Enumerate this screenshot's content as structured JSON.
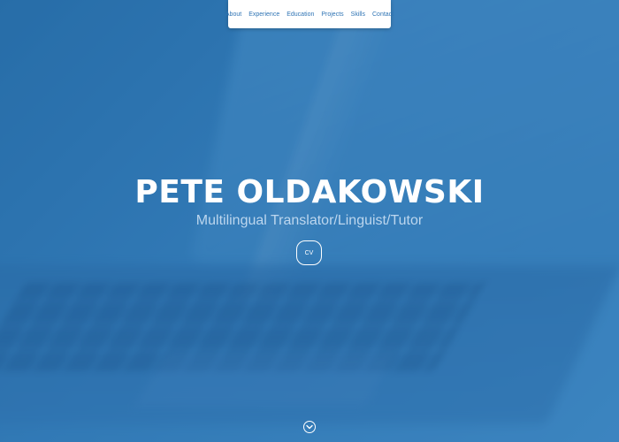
{
  "nav": {
    "items": [
      {
        "label": "About"
      },
      {
        "label": "Experience"
      },
      {
        "label": "Education"
      },
      {
        "label": "Projects"
      },
      {
        "label": "Skills"
      },
      {
        "label": "Contact"
      }
    ]
  },
  "hero": {
    "title": "PETE OLDAKOWSKI",
    "subtitle": "Multilingual Translator/Linguist/Tutor",
    "cv_label": "CV",
    "scroll_icon": "chevron-down-icon"
  },
  "colors": {
    "background": "#3a82bd",
    "nav_link": "#2f74b4",
    "nav_background": "#ffffff",
    "title": "#ffffff",
    "subtitle": "#bcd6ee"
  }
}
